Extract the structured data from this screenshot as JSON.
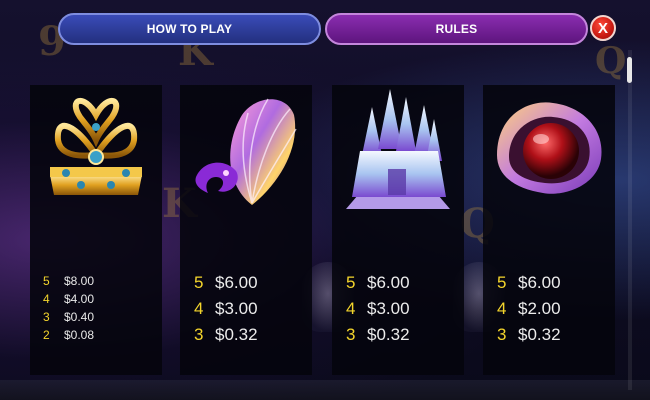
{
  "header": {
    "tabs": [
      {
        "label": "HOW TO PLAY",
        "active": false
      },
      {
        "label": "RULES",
        "active": true
      }
    ],
    "close_label": "X"
  },
  "colors": {
    "how_to_play_tab": "#2c3a9a",
    "rules_tab": "#7a1fa0",
    "close_button": "#d2231a",
    "count_text": "#f4d52c",
    "amount_text": "#ececec"
  },
  "paytable": [
    {
      "symbol": "crown-icon",
      "payouts": [
        {
          "count": "5",
          "amount": "$8.00"
        },
        {
          "count": "4",
          "amount": "$4.00"
        },
        {
          "count": "3",
          "amount": "$0.40"
        },
        {
          "count": "2",
          "amount": "$0.08"
        }
      ]
    },
    {
      "symbol": "seashell-icon",
      "payouts": [
        {
          "count": "5",
          "amount": "$6.00"
        },
        {
          "count": "4",
          "amount": "$3.00"
        },
        {
          "count": "3",
          "amount": "$0.32"
        }
      ]
    },
    {
      "symbol": "ice-castle-icon",
      "payouts": [
        {
          "count": "5",
          "amount": "$6.00"
        },
        {
          "count": "4",
          "amount": "$3.00"
        },
        {
          "count": "3",
          "amount": "$0.32"
        }
      ]
    },
    {
      "symbol": "pearl-clam-icon",
      "payouts": [
        {
          "count": "5",
          "amount": "$6.00"
        },
        {
          "count": "4",
          "amount": "$2.00"
        },
        {
          "count": "3",
          "amount": "$0.32"
        }
      ]
    }
  ]
}
